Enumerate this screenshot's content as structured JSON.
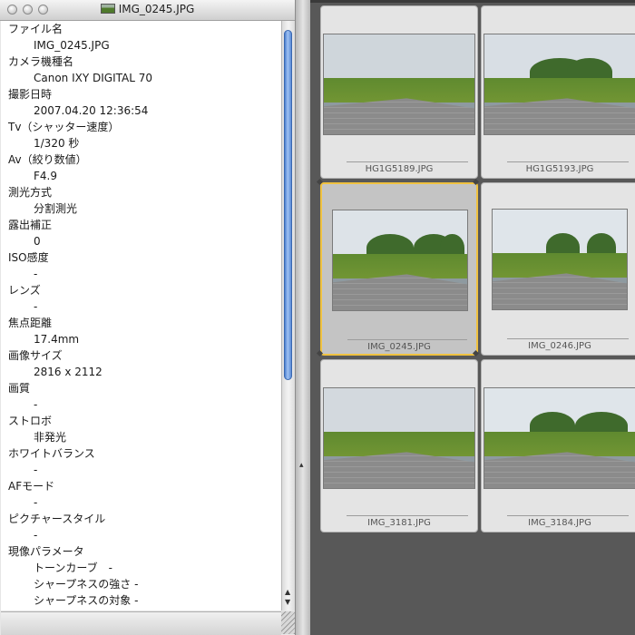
{
  "window": {
    "title": "IMG_0245.JPG",
    "title_icon": "image-file-icon"
  },
  "info_rows": [
    {
      "kind": "label",
      "text": "ファイル名"
    },
    {
      "kind": "value",
      "text": "IMG_0245.JPG"
    },
    {
      "kind": "label",
      "text": "カメラ機種名"
    },
    {
      "kind": "value",
      "text": "Canon IXY DIGITAL 70"
    },
    {
      "kind": "label",
      "text": "撮影日時"
    },
    {
      "kind": "value",
      "text": "2007.04.20 12:36:54"
    },
    {
      "kind": "label",
      "text": "Tv（シャッター速度）"
    },
    {
      "kind": "value",
      "text": "1/320 秒"
    },
    {
      "kind": "label",
      "text": "Av（絞り数値）"
    },
    {
      "kind": "value",
      "text": "F4.9"
    },
    {
      "kind": "label",
      "text": "測光方式"
    },
    {
      "kind": "value",
      "text": "分割測光"
    },
    {
      "kind": "label",
      "text": "露出補正"
    },
    {
      "kind": "value",
      "text": "0"
    },
    {
      "kind": "label",
      "text": "ISO感度"
    },
    {
      "kind": "value",
      "text": "-"
    },
    {
      "kind": "label",
      "text": "レンズ"
    },
    {
      "kind": "value",
      "text": "-"
    },
    {
      "kind": "label",
      "text": "焦点距離"
    },
    {
      "kind": "value",
      "text": "17.4mm"
    },
    {
      "kind": "label",
      "text": "画像サイズ"
    },
    {
      "kind": "value",
      "text": "2816 x 2112"
    },
    {
      "kind": "label",
      "text": "画質"
    },
    {
      "kind": "value",
      "text": "-"
    },
    {
      "kind": "label",
      "text": "ストロボ"
    },
    {
      "kind": "value",
      "text": "非発光"
    },
    {
      "kind": "label",
      "text": "ホワイトバランス"
    },
    {
      "kind": "value",
      "text": "-"
    },
    {
      "kind": "label",
      "text": "AFモード"
    },
    {
      "kind": "value",
      "text": "-"
    },
    {
      "kind": "label",
      "text": "ピクチャースタイル"
    },
    {
      "kind": "value",
      "text": "-"
    },
    {
      "kind": "label",
      "text": "現像パラメータ"
    },
    {
      "kind": "value",
      "text": "トーンカーブ　-"
    },
    {
      "kind": "value",
      "text": "シャープネスの強さ -"
    },
    {
      "kind": "value",
      "text": "シャープネスの対象 -"
    }
  ],
  "thumbnails": [
    {
      "filename": "HG1G5189.JPG",
      "selected": false
    },
    {
      "filename": "HG1G5193.JPG",
      "selected": false
    },
    {
      "filename": "IMG_0245.JPG",
      "selected": true
    },
    {
      "filename": "IMG_0246.JPG",
      "selected": false
    },
    {
      "filename": "IMG_3181.JPG",
      "selected": false
    },
    {
      "filename": "IMG_3184.JPG",
      "selected": false
    }
  ],
  "colors": {
    "selection_border": "#f0c240",
    "scroll_thumb": "#6f9fe0"
  }
}
